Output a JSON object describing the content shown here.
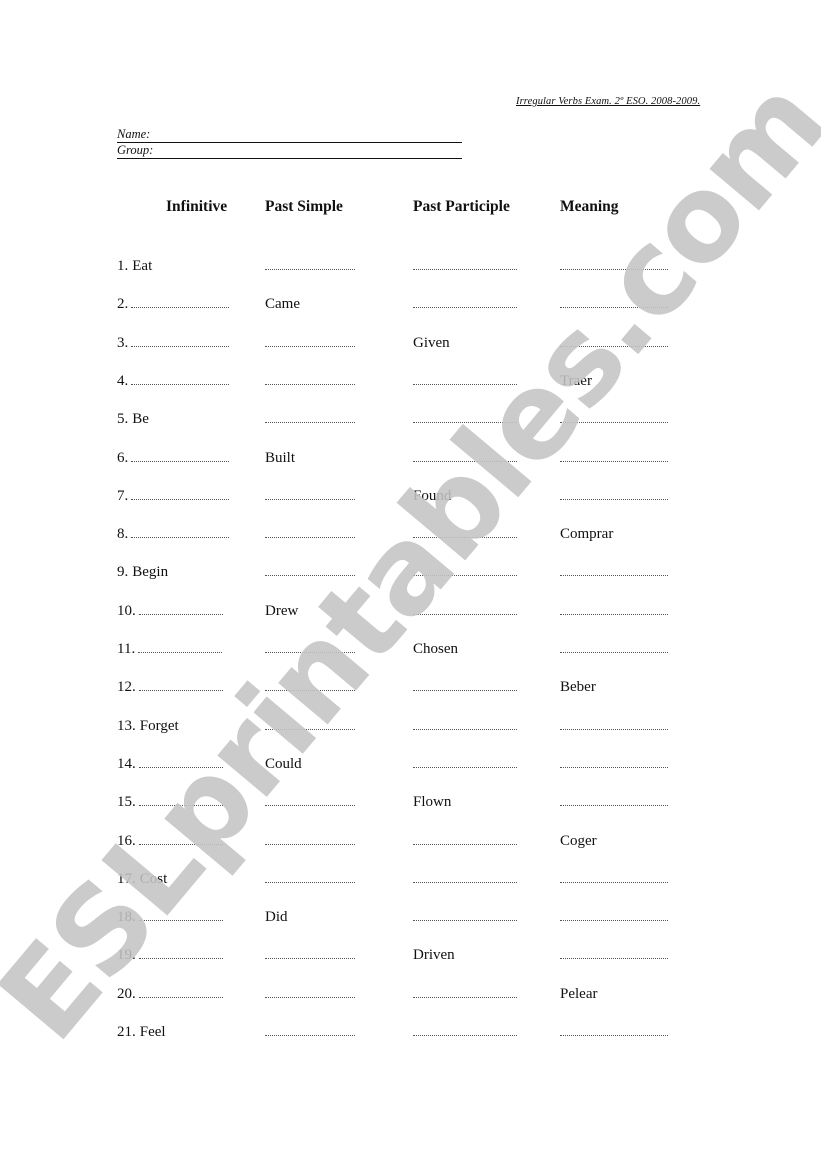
{
  "document": {
    "exam_title": "Irregular Verbs Exam. 2º ESO. 2008-2009.",
    "name_label": "Name:",
    "group_label": "Group:",
    "watermark": "ESLprintables.com"
  },
  "table": {
    "headers": [
      "Infinitive",
      "Past Simple",
      "Past Participle",
      "Meaning"
    ],
    "rows": [
      {
        "num": "1.",
        "infinitive": "Eat",
        "past_simple": "",
        "past_participle": "",
        "meaning": ""
      },
      {
        "num": "2.",
        "infinitive": "",
        "past_simple": "Came",
        "past_participle": "",
        "meaning": ""
      },
      {
        "num": "3.",
        "infinitive": "",
        "past_simple": "",
        "past_participle": "Given",
        "meaning": ""
      },
      {
        "num": "4.",
        "infinitive": "",
        "past_simple": "",
        "past_participle": "",
        "meaning": "Traer"
      },
      {
        "num": "5.",
        "infinitive": "Be",
        "past_simple": "",
        "past_participle": "",
        "meaning": ""
      },
      {
        "num": "6.",
        "infinitive": "",
        "past_simple": "Built",
        "past_participle": "",
        "meaning": ""
      },
      {
        "num": "7.",
        "infinitive": "",
        "past_simple": "",
        "past_participle": "Found",
        "meaning": ""
      },
      {
        "num": "8.",
        "infinitive": "",
        "past_simple": "",
        "past_participle": "",
        "meaning": "Comprar"
      },
      {
        "num": "9.",
        "infinitive": "Begin",
        "past_simple": "",
        "past_participle": "",
        "meaning": ""
      },
      {
        "num": "10.",
        "infinitive": "",
        "past_simple": "Drew",
        "past_participle": "",
        "meaning": ""
      },
      {
        "num": "11.",
        "infinitive": "",
        "past_simple": "",
        "past_participle": "Chosen",
        "meaning": ""
      },
      {
        "num": "12.",
        "infinitive": "",
        "past_simple": "",
        "past_participle": "",
        "meaning": "Beber"
      },
      {
        "num": "13.",
        "infinitive": "Forget",
        "past_simple": "",
        "past_participle": "",
        "meaning": ""
      },
      {
        "num": "14.",
        "infinitive": "",
        "past_simple": "Could",
        "past_participle": "",
        "meaning": ""
      },
      {
        "num": "15.",
        "infinitive": "",
        "past_simple": "",
        "past_participle": "Flown",
        "meaning": ""
      },
      {
        "num": "16.",
        "infinitive": "",
        "past_simple": "",
        "past_participle": "",
        "meaning": "Coger"
      },
      {
        "num": "17.",
        "infinitive": "Cost",
        "past_simple": "",
        "past_participle": "",
        "meaning": ""
      },
      {
        "num": "18.",
        "infinitive": "",
        "past_simple": "Did",
        "past_participle": "",
        "meaning": ""
      },
      {
        "num": "19.",
        "infinitive": "",
        "past_simple": "",
        "past_participle": "Driven",
        "meaning": ""
      },
      {
        "num": "20.",
        "infinitive": "",
        "past_simple": "",
        "past_participle": "",
        "meaning": "Pelear"
      },
      {
        "num": "21.",
        "infinitive": "Feel",
        "past_simple": "",
        "past_participle": "",
        "meaning": ""
      }
    ]
  }
}
